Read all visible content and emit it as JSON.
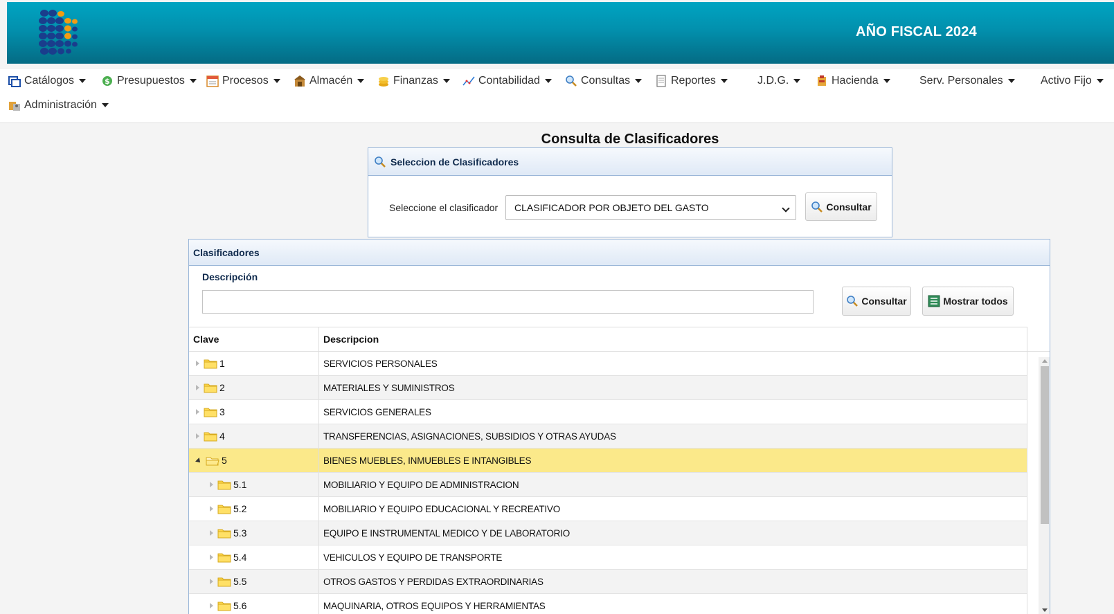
{
  "header": {
    "fiscal_year_label": "AÑO FISCAL  2024"
  },
  "menu": {
    "items": [
      {
        "label": "Catálogos",
        "icon": "catalog-window-icon"
      },
      {
        "label": "Presupuestos",
        "icon": "money-icon"
      },
      {
        "label": "Procesos",
        "icon": "calendar-icon"
      },
      {
        "label": "Almacén",
        "icon": "warehouse-icon"
      },
      {
        "label": "Finanzas",
        "icon": "coins-icon"
      },
      {
        "label": "Contabilidad",
        "icon": "line-chart-icon"
      },
      {
        "label": "Consultas",
        "icon": "magnifier-icon"
      },
      {
        "label": "Reportes",
        "icon": "document-icon"
      },
      {
        "label": "J.D.G.",
        "icon": ""
      },
      {
        "label": "Hacienda",
        "icon": "treasury-icon"
      },
      {
        "label": "Serv. Personales",
        "icon": ""
      },
      {
        "label": "Activo Fijo",
        "icon": ""
      },
      {
        "label": "Administración",
        "icon": "admin-icon"
      }
    ]
  },
  "page": {
    "title": "Consulta de Clasificadores"
  },
  "selection_panel": {
    "title": "Seleccion de Clasificadores",
    "select_label": "Seleccione el clasificador",
    "selected_value": "CLASIFICADOR POR OBJETO DEL GASTO",
    "consult_button": "Consultar"
  },
  "clasificadores": {
    "title": "Clasificadores",
    "description_label": "Descripción",
    "description_value": "",
    "consult_button": "Consultar",
    "show_all_button": "Mostrar todos",
    "columns": [
      "Clave",
      "Descripcion"
    ],
    "rows": [
      {
        "clave": "1",
        "descripcion": "SERVICIOS PERSONALES",
        "level": 0,
        "expanded": false,
        "selected": false
      },
      {
        "clave": "2",
        "descripcion": "MATERIALES Y SUMINISTROS",
        "level": 0,
        "expanded": false,
        "selected": false
      },
      {
        "clave": "3",
        "descripcion": "SERVICIOS GENERALES",
        "level": 0,
        "expanded": false,
        "selected": false
      },
      {
        "clave": "4",
        "descripcion": "TRANSFERENCIAS, ASIGNACIONES, SUBSIDIOS Y OTRAS AYUDAS",
        "level": 0,
        "expanded": false,
        "selected": false
      },
      {
        "clave": "5",
        "descripcion": "BIENES MUEBLES, INMUEBLES E INTANGIBLES",
        "level": 0,
        "expanded": true,
        "selected": true
      },
      {
        "clave": "5.1",
        "descripcion": "MOBILIARIO Y EQUIPO DE ADMINISTRACION",
        "level": 1,
        "expanded": false,
        "selected": false
      },
      {
        "clave": "5.2",
        "descripcion": "MOBILIARIO Y EQUIPO EDUCACIONAL Y RECREATIVO",
        "level": 1,
        "expanded": false,
        "selected": false
      },
      {
        "clave": "5.3",
        "descripcion": "EQUIPO E INSTRUMENTAL MEDICO Y DE LABORATORIO",
        "level": 1,
        "expanded": false,
        "selected": false
      },
      {
        "clave": "5.4",
        "descripcion": "VEHICULOS Y EQUIPO DE TRANSPORTE",
        "level": 1,
        "expanded": false,
        "selected": false
      },
      {
        "clave": "5.5",
        "descripcion": "OTROS GASTOS Y PERDIDAS EXTRAORDINARIAS",
        "level": 1,
        "expanded": false,
        "selected": false
      },
      {
        "clave": "5.6",
        "descripcion": "MAQUINARIA, OTROS EQUIPOS Y HERRAMIENTAS",
        "level": 1,
        "expanded": false,
        "selected": false
      }
    ]
  },
  "colors": {
    "header_top": "#00a4c2",
    "header_bottom": "#046b84",
    "selected_row": "#fbe98a",
    "panel_border": "#9ab6d8"
  }
}
